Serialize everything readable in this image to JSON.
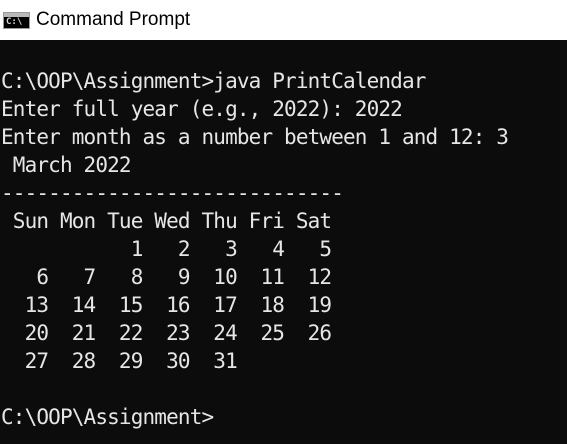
{
  "window": {
    "title": "Command Prompt",
    "icon": "cmd-icon",
    "icon_glyph": "C:\\",
    "colors": {
      "titlebar_bg": "#ffffff",
      "console_bg": "#0c0c0c",
      "console_text": "#e6e6e6"
    }
  },
  "console": {
    "lines": [
      "",
      "C:\\OOP\\Assignment>java PrintCalendar",
      "Enter full year (e.g., 2022): 2022",
      "Enter month as a number between 1 and 12: 3",
      " March 2022",
      "-----------------------------",
      " Sun Mon Tue Wed Thu Fri Sat",
      "           1   2   3   4   5",
      "   6   7   8   9  10  11  12",
      "  13  14  15  16  17  18  19",
      "  20  21  22  23  24  25  26",
      "  27  28  29  30  31",
      "",
      "C:\\OOP\\Assignment>"
    ]
  }
}
